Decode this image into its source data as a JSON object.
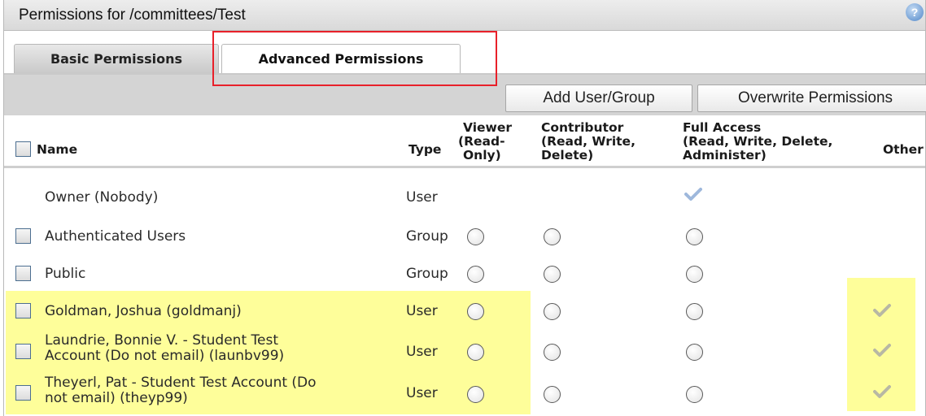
{
  "window": {
    "title": "Permissions for /committees/Test",
    "help_icon": "?"
  },
  "tabs": [
    {
      "label": "Basic Permissions",
      "active": false
    },
    {
      "label": "Advanced Permissions",
      "active": true
    }
  ],
  "toolbar": {
    "add_label": "Add User/Group",
    "overwrite_label": "Overwrite Permissions"
  },
  "table": {
    "headers": {
      "name": "Name",
      "type": "Type",
      "viewer": [
        "Viewer",
        "(Read-",
        "Only)"
      ],
      "contributor": [
        "Contributor",
        "(Read, Write,",
        "Delete)"
      ],
      "full": [
        "Full Access",
        "(Read, Write, Delete,",
        "Administer)"
      ],
      "other": "Other"
    },
    "rows": [
      {
        "name": [
          "Owner (Nobody)"
        ],
        "type": "User",
        "checkbox": false,
        "radios": false,
        "full_check": true,
        "other_check": false,
        "highlight": false
      },
      {
        "name": [
          "Authenticated Users"
        ],
        "type": "Group",
        "checkbox": true,
        "radios": true,
        "full_check": false,
        "other_check": false,
        "highlight": false
      },
      {
        "name": [
          "Public"
        ],
        "type": "Group",
        "checkbox": true,
        "radios": true,
        "full_check": false,
        "other_check": false,
        "highlight": false
      },
      {
        "name": [
          "Goldman, Joshua (goldmanj)"
        ],
        "type": "User",
        "checkbox": true,
        "radios": true,
        "full_check": false,
        "other_check": true,
        "highlight": true
      },
      {
        "name": [
          "Laundrie, Bonnie V. - Student Test",
          "Account (Do not email) (launbv99)"
        ],
        "type": "User",
        "checkbox": true,
        "radios": true,
        "full_check": false,
        "other_check": true,
        "highlight": true
      },
      {
        "name": [
          "Theyerl, Pat - Student Test Account (Do",
          "not email) (theyp99)"
        ],
        "type": "User",
        "checkbox": true,
        "radios": true,
        "full_check": false,
        "other_check": true,
        "highlight": true
      }
    ]
  },
  "colors": {
    "highlight": "#fefe9a",
    "annotation": "#e8202a",
    "toolbar": "#d4d4d4"
  }
}
